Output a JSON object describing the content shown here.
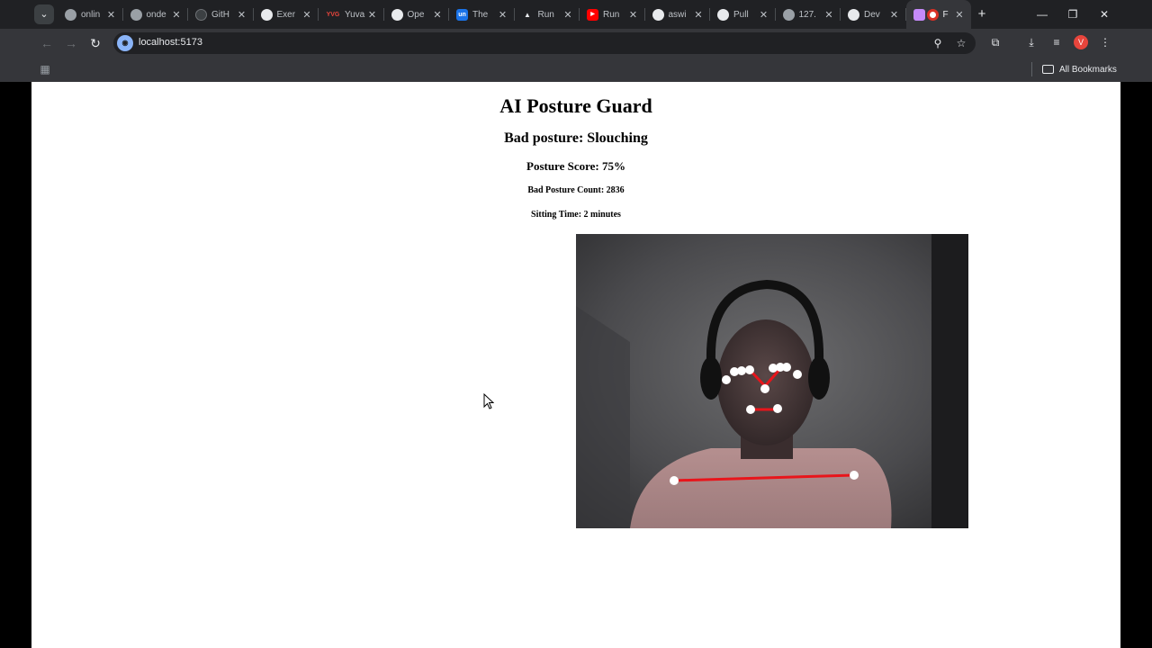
{
  "browser": {
    "tabs": [
      {
        "title": "onlin",
        "icon": "globe-icon",
        "active": false
      },
      {
        "title": "onde",
        "icon": "globe-icon",
        "active": false
      },
      {
        "title": "GitH",
        "icon": "github-icon",
        "active": false
      },
      {
        "title": "Exer",
        "icon": "github-icon",
        "active": false
      },
      {
        "title": "Yuva",
        "icon": "yuva-icon",
        "active": false
      },
      {
        "title": "Ope",
        "icon": "github-icon",
        "active": false
      },
      {
        "title": "The",
        "icon": "un-icon",
        "active": false
      },
      {
        "title": "Run",
        "icon": "triangle-icon",
        "active": false
      },
      {
        "title": "Run",
        "icon": "youtube-icon",
        "active": false
      },
      {
        "title": "aswi",
        "icon": "github-icon",
        "active": false
      },
      {
        "title": "Pull",
        "icon": "github-icon",
        "active": false
      },
      {
        "title": "127.",
        "icon": "globe-icon",
        "active": false
      },
      {
        "title": "Dev",
        "icon": "github-icon",
        "active": false
      },
      {
        "title": "F",
        "icon": "app-icon",
        "active": true
      }
    ],
    "address": "localhost:5173",
    "profile_initial": "V",
    "bookmarks_label": "All Bookmarks"
  },
  "app": {
    "title": "AI Posture Guard",
    "status": "Bad posture: Slouching",
    "score_label": "Posture Score: 75%",
    "score_value": 75,
    "bad_count_label": "Bad Posture Count: 2836",
    "bad_count_value": 2836,
    "sitting_time_label": "Sitting Time: 2 minutes"
  },
  "webcam": {
    "landmark_color": "#ffffff",
    "connection_color": "#e8151b"
  }
}
